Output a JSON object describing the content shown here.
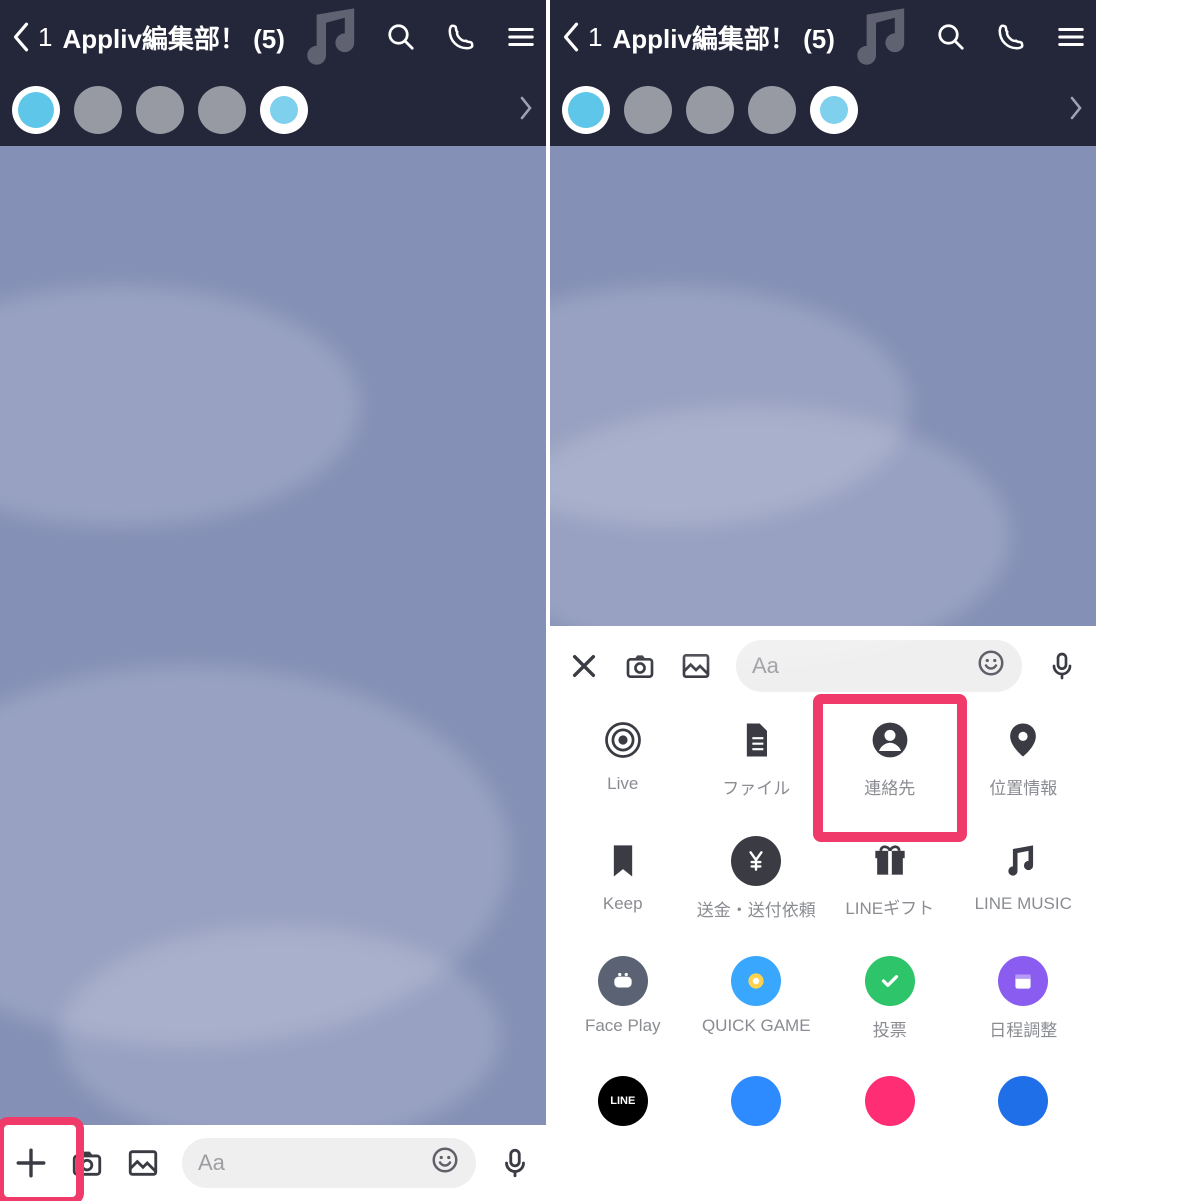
{
  "header": {
    "back_count": "1",
    "title": "Appliv編集部！ (5)"
  },
  "input": {
    "placeholder": "Aa"
  },
  "attachments": {
    "row1": [
      {
        "id": "live",
        "label": "Live"
      },
      {
        "id": "file",
        "label": "ファイル"
      },
      {
        "id": "contact",
        "label": "連絡先"
      },
      {
        "id": "location",
        "label": "位置情報"
      }
    ],
    "row2": [
      {
        "id": "keep",
        "label": "Keep"
      },
      {
        "id": "transfer",
        "label": "送金・送付依頼"
      },
      {
        "id": "gift",
        "label": "LINEギフト"
      },
      {
        "id": "music",
        "label": "LINE MUSIC"
      }
    ],
    "row3": [
      {
        "id": "faceplay",
        "label": "Face Play"
      },
      {
        "id": "quickgame",
        "label": "QUICK GAME"
      },
      {
        "id": "poll",
        "label": "投票"
      },
      {
        "id": "schedule",
        "label": "日程調整"
      }
    ]
  },
  "colors": {
    "highlight": "#f03a6a",
    "header_bg": "#24273a",
    "chat_bg": "#8590b6"
  }
}
